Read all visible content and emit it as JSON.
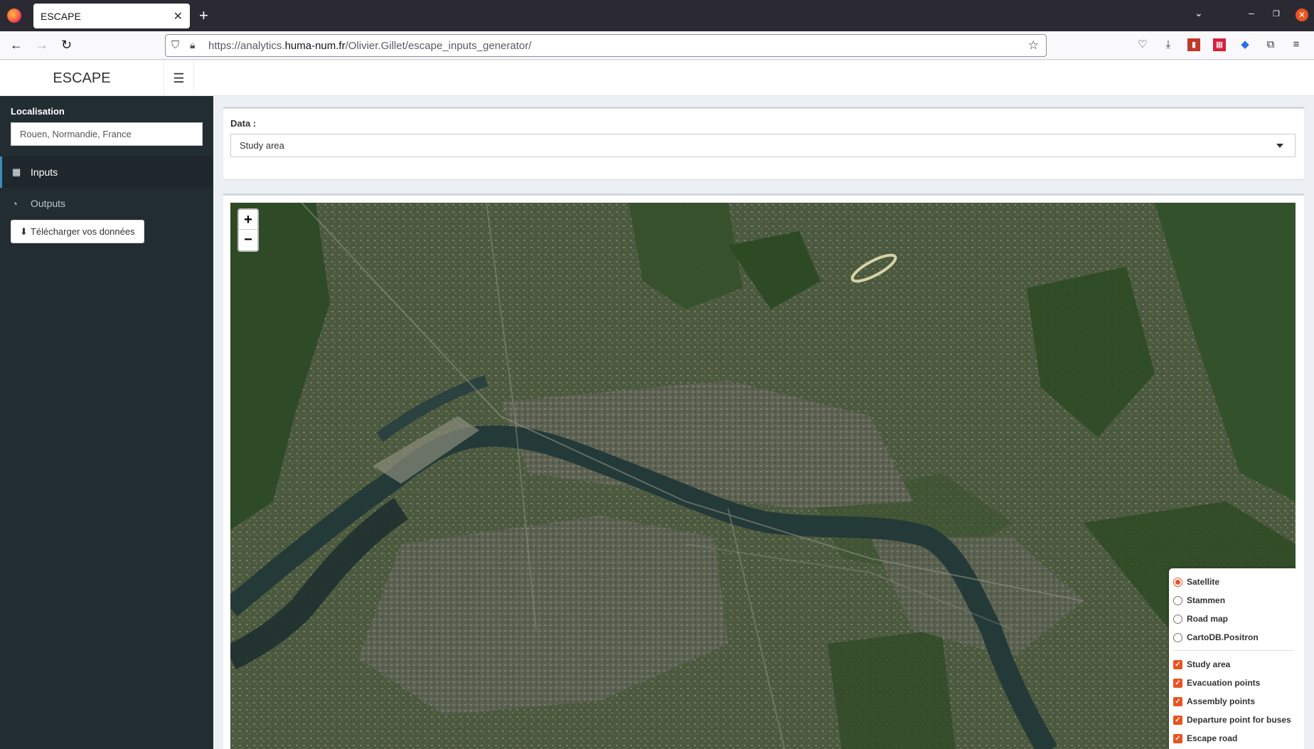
{
  "browser": {
    "tab_title": "ESCAPE",
    "url_prefix": "https://analytics.",
    "url_host": "huma-num.fr",
    "url_path": "/Olivier.Gillet/escape_inputs_generator/"
  },
  "app": {
    "brand": "ESCAPE"
  },
  "sidebar": {
    "localisation_label": "Localisation",
    "localisation_value": "Rouen, Normandie, France",
    "items": [
      {
        "label": "Inputs",
        "icon": "grid-icon"
      },
      {
        "label": "Outputs",
        "icon": "dashboard-icon"
      }
    ],
    "download_label": "Télécharger vos données"
  },
  "main": {
    "data_label": "Data :",
    "data_selected": "Study area"
  },
  "map": {
    "basemaps": [
      "Satellite",
      "Stammen",
      "Road map",
      "CartoDB.Positron"
    ],
    "selected_basemap": "Satellite",
    "overlays": [
      "Study area",
      "Evacuation points",
      "Assembly points",
      "Departure point for buses",
      "Escape road"
    ],
    "zoom_in": "+",
    "zoom_out": "−",
    "accent": "#e95420"
  }
}
